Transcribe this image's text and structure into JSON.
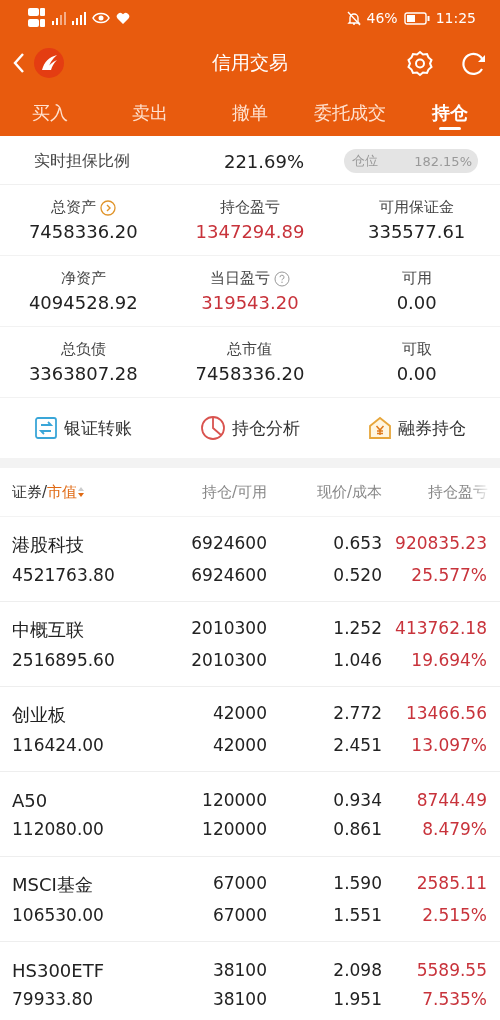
{
  "status_bar": {
    "battery": "46%",
    "time": "11:25"
  },
  "nav": {
    "title": "信用交易"
  },
  "tabs": [
    {
      "label": "买入",
      "selected": false
    },
    {
      "label": "卖出",
      "selected": false
    },
    {
      "label": "撤单",
      "selected": false
    },
    {
      "label": "委托成交",
      "selected": false
    },
    {
      "label": "持仓",
      "selected": true
    }
  ],
  "ratio": {
    "label": "实时担保比例",
    "value": "221.69%",
    "position_label": "仓位",
    "position_value": "182.15%"
  },
  "stats": [
    {
      "label": "总资产",
      "value": "7458336.20",
      "kind": "link",
      "color": "#222222"
    },
    {
      "label": "持仓盈亏",
      "value": "1347294.89",
      "kind": "plain",
      "color": "#c8333b"
    },
    {
      "label": "可用保证金",
      "value": "335577.61",
      "kind": "plain",
      "color": "#222222"
    },
    {
      "label": "净资产",
      "value": "4094528.92",
      "kind": "plain",
      "color": "#222222"
    },
    {
      "label": "当日盈亏",
      "value": "319543.20",
      "kind": "help",
      "color": "#c8333b"
    },
    {
      "label": "可用",
      "value": "0.00",
      "kind": "plain",
      "color": "#222222"
    },
    {
      "label": "总负债",
      "value": "3363807.28",
      "kind": "plain",
      "color": "#222222"
    },
    {
      "label": "总市值",
      "value": "7458336.20",
      "kind": "plain",
      "color": "#222222"
    },
    {
      "label": "可取",
      "value": "0.00",
      "kind": "plain",
      "color": "#222222"
    }
  ],
  "actions": [
    {
      "label": "银证转账",
      "kind": "transfer"
    },
    {
      "label": "持仓分析",
      "kind": "analysis"
    },
    {
      "label": "融券持仓",
      "kind": "lending"
    }
  ],
  "table": {
    "columns": [
      {
        "label": "证券/",
        "sort_label": "市值"
      },
      {
        "label": "持仓/可用"
      },
      {
        "label": "现价/成本"
      },
      {
        "label": "持仓盈亏"
      }
    ],
    "rows": [
      {
        "name": "港股科技",
        "market_value": "4521763.80",
        "holding": "6924600",
        "available": "6924600",
        "price": "0.653",
        "cost": "0.520",
        "pnl": "920835.23",
        "pnl_pct": "25.577%"
      },
      {
        "name": "中概互联",
        "market_value": "2516895.60",
        "holding": "2010300",
        "available": "2010300",
        "price": "1.252",
        "cost": "1.046",
        "pnl": "413762.18",
        "pnl_pct": "19.694%"
      },
      {
        "name": "创业板",
        "market_value": "116424.00",
        "holding": "42000",
        "available": "42000",
        "price": "2.772",
        "cost": "2.451",
        "pnl": "13466.56",
        "pnl_pct": "13.097%"
      },
      {
        "name": "A50",
        "market_value": "112080.00",
        "holding": "120000",
        "available": "120000",
        "price": "0.934",
        "cost": "0.861",
        "pnl": "8744.49",
        "pnl_pct": "8.479%"
      },
      {
        "name": "MSCI基金",
        "market_value": "106530.00",
        "holding": "67000",
        "available": "67000",
        "price": "1.590",
        "cost": "1.551",
        "pnl": "2585.11",
        "pnl_pct": "2.515%"
      },
      {
        "name": "HS300ETF",
        "market_value": "79933.80",
        "holding": "38100",
        "available": "38100",
        "price": "2.098",
        "cost": "1.951",
        "pnl": "5589.55",
        "pnl_pct": "7.535%"
      }
    ]
  }
}
